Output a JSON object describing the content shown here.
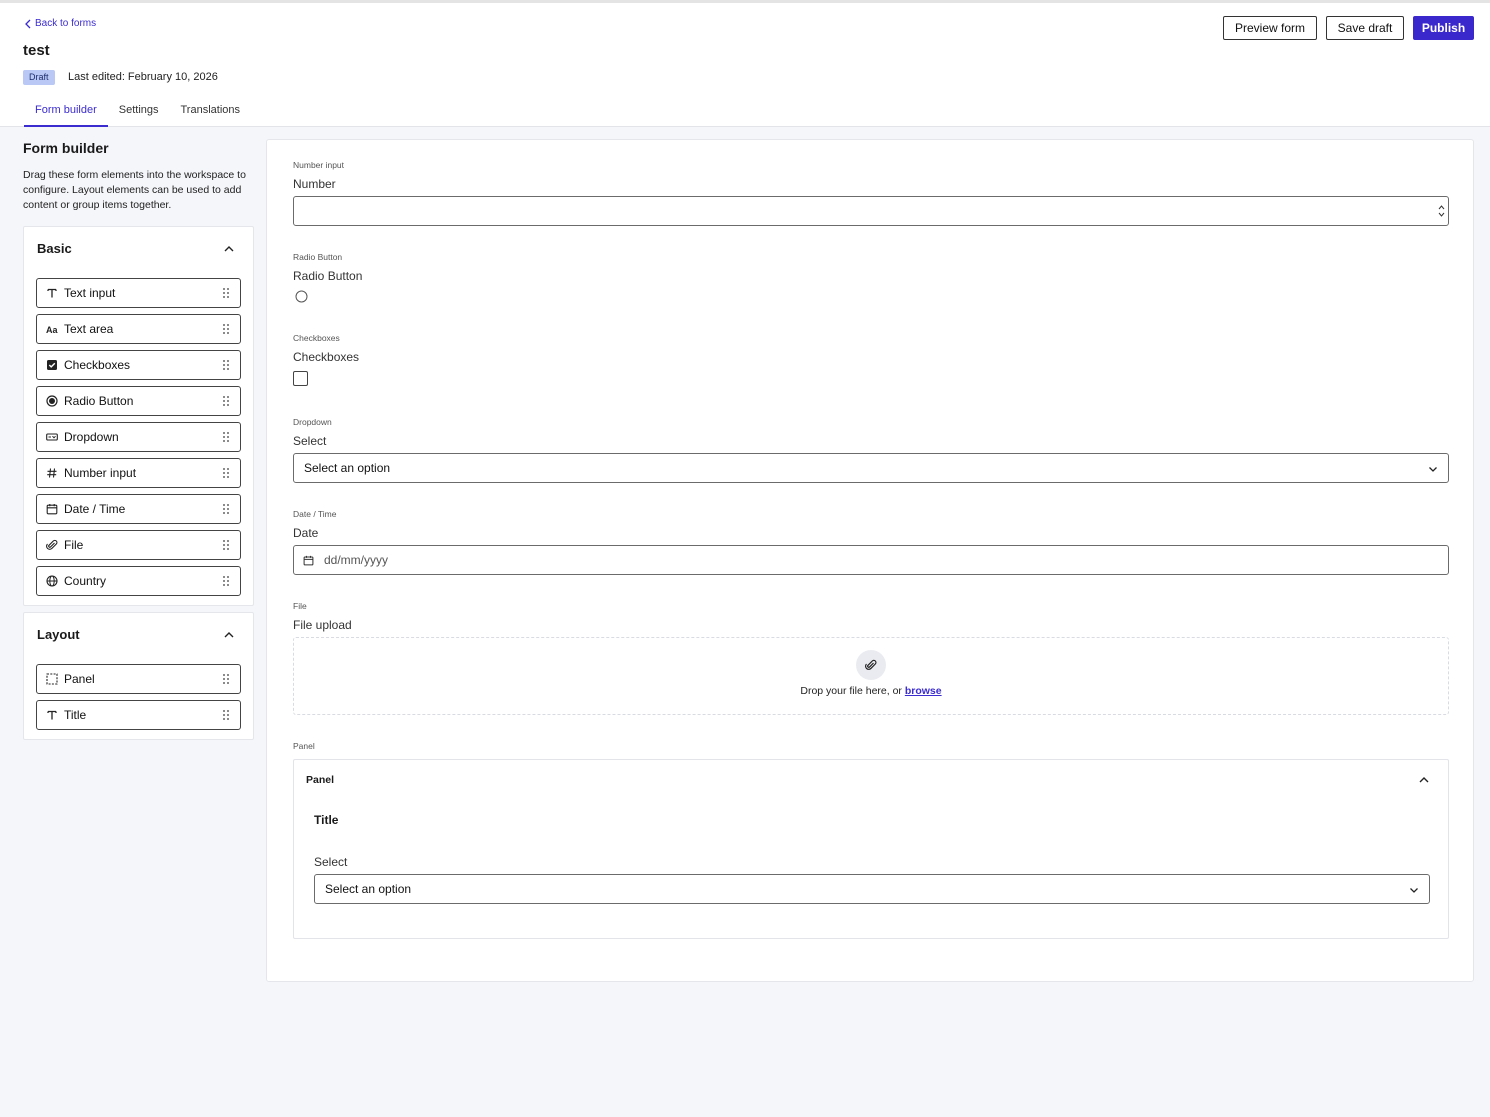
{
  "header": {
    "back_label": "Back to forms",
    "title": "test",
    "badge": "Draft",
    "last_edited": "Last edited: February 10, 2026",
    "buttons": {
      "preview": "Preview form",
      "save": "Save draft",
      "publish": "Publish"
    },
    "tabs": [
      "Form builder",
      "Settings",
      "Translations"
    ],
    "active_tab": "Form builder"
  },
  "sidebar": {
    "title": "Form builder",
    "description": "Drag these form elements into the workspace to configure. Layout elements can be used to add content or group items together.",
    "basic": {
      "title": "Basic",
      "items": [
        {
          "label": "Text input",
          "icon": "text-icon"
        },
        {
          "label": "Text area",
          "icon": "text-area-icon"
        },
        {
          "label": "Checkboxes",
          "icon": "checkbox-icon"
        },
        {
          "label": "Radio Button",
          "icon": "radio-icon"
        },
        {
          "label": "Dropdown",
          "icon": "dropdown-icon"
        },
        {
          "label": "Number input",
          "icon": "hash-icon"
        },
        {
          "label": "Date / Time",
          "icon": "calendar-icon"
        },
        {
          "label": "File",
          "icon": "paperclip-icon"
        },
        {
          "label": "Country",
          "icon": "globe-icon"
        }
      ]
    },
    "layout": {
      "title": "Layout",
      "items": [
        {
          "label": "Panel",
          "icon": "panel-icon"
        },
        {
          "label": "Title",
          "icon": "text-icon"
        }
      ]
    }
  },
  "workspace": {
    "number": {
      "type": "Number input",
      "label": "Number",
      "value": ""
    },
    "radio": {
      "type": "Radio Button",
      "label": "Radio Button"
    },
    "checkboxes": {
      "type": "Checkboxes",
      "label": "Checkboxes"
    },
    "dropdown": {
      "type": "Dropdown",
      "label": "Select",
      "placeholder": "Select an option"
    },
    "date": {
      "type": "Date / Time",
      "label": "Date",
      "placeholder": "dd/mm/yyyy"
    },
    "file": {
      "type": "File",
      "label": "File upload",
      "drop_text": "Drop your file here, or ",
      "browse": "browse"
    },
    "panel": {
      "type": "Panel",
      "title": "Panel",
      "inner_title": "Title",
      "select_label": "Select",
      "select_placeholder": "Select an option"
    }
  },
  "colors": {
    "accent": "#3b28cc",
    "badge_bg": "#b9c8f4",
    "page_bg": "#f5f6fa"
  }
}
